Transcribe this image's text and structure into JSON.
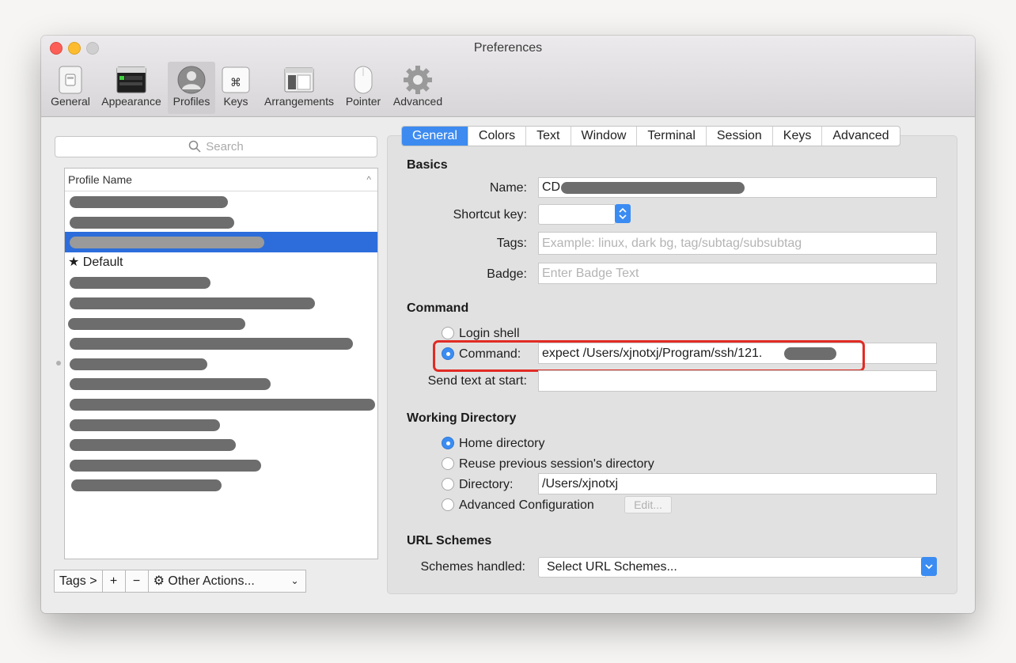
{
  "window": {
    "title": "Preferences"
  },
  "toolbar": {
    "items": [
      {
        "label": "General",
        "icon": "general-switch-icon"
      },
      {
        "label": "Appearance",
        "icon": "appearance-terminal-icon"
      },
      {
        "label": "Profiles",
        "icon": "profiles-person-icon"
      },
      {
        "label": "Keys",
        "icon": "keys-command-icon"
      },
      {
        "label": "Arrangements",
        "icon": "arrangements-windows-icon"
      },
      {
        "label": "Pointer",
        "icon": "pointer-mouse-icon"
      },
      {
        "label": "Advanced",
        "icon": "advanced-gear-icon"
      }
    ],
    "active": "Profiles"
  },
  "left": {
    "search_placeholder": "Search",
    "list_header": "Profile Name",
    "profiles": [
      "",
      "",
      "",
      "★ Default",
      "",
      "",
      "",
      "",
      "",
      "",
      "",
      "",
      "",
      "",
      ""
    ],
    "selected_index": 2,
    "bottom": {
      "tags": "Tags >",
      "add": "+",
      "remove": "−",
      "other_actions": "Other Actions..."
    }
  },
  "tabs": [
    "General",
    "Colors",
    "Text",
    "Window",
    "Terminal",
    "Session",
    "Keys",
    "Advanced"
  ],
  "active_tab": "General",
  "basics": {
    "heading": "Basics",
    "name_label": "Name:",
    "name_value": "CD",
    "shortcut_label": "Shortcut key:",
    "tags_label": "Tags:",
    "tags_placeholder": "Example: linux, dark bg, tag/subtag/subsubtag",
    "badge_label": "Badge:",
    "badge_placeholder": "Enter Badge Text"
  },
  "command": {
    "heading": "Command",
    "login_shell": "Login shell",
    "command_label": "Command:",
    "command_value": "expect /Users/xjnotxj/Program/ssh/121.",
    "send_text_label": "Send text at start:",
    "selected": "Command"
  },
  "working_directory": {
    "heading": "Working Directory",
    "home": "Home directory",
    "reuse": "Reuse previous session's directory",
    "directory_label": "Directory:",
    "directory_value": "/Users/xjnotxj",
    "advanced": "Advanced Configuration",
    "edit": "Edit...",
    "selected": "Home directory"
  },
  "url_schemes": {
    "heading": "URL Schemes",
    "handled_label": "Schemes handled:",
    "select_value": "Select URL Schemes..."
  },
  "colors": {
    "accent": "#3b8cf2",
    "selection": "#2c6ddb",
    "highlight_box": "#e12b24"
  }
}
